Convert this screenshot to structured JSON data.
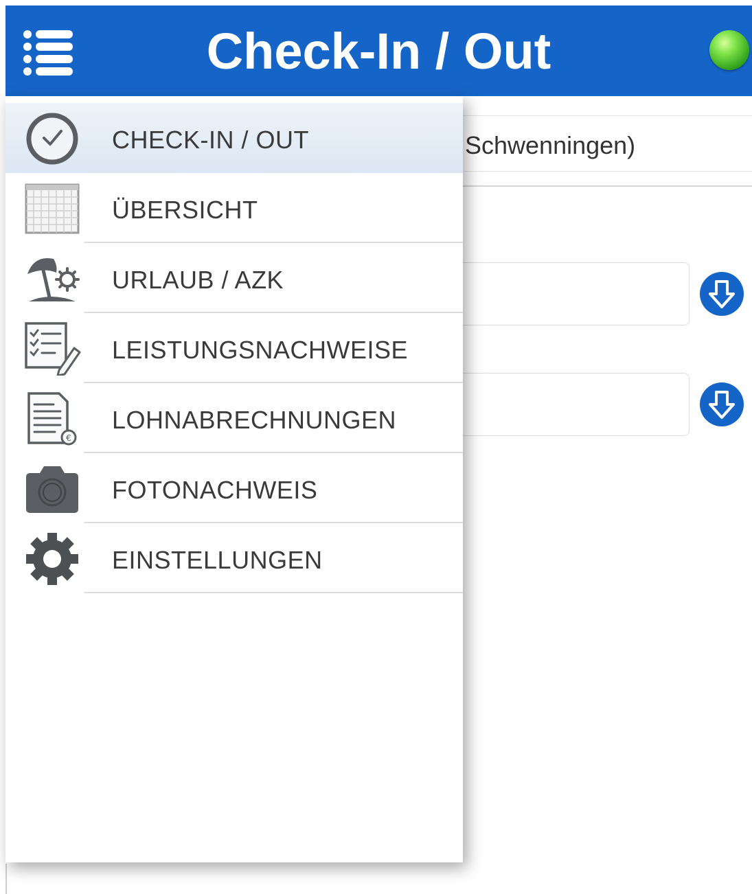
{
  "header": {
    "title": "Check-In / Out",
    "status_icon": "green-status-light",
    "menu_icon": "list-menu-icon"
  },
  "background": {
    "location_text": "Schwenningen)"
  },
  "menu": {
    "items": [
      {
        "label": "CHECK-IN / OUT",
        "icon": "clock-icon",
        "active": true
      },
      {
        "label": "ÜBERSICHT",
        "icon": "calendar-icon",
        "active": false
      },
      {
        "label": "URLAUB / AZK",
        "icon": "beach-umbrella-icon",
        "active": false
      },
      {
        "label": "LEISTUNGSNACHWEISE",
        "icon": "checklist-icon",
        "active": false
      },
      {
        "label": "LOHNABRECHNUNGEN",
        "icon": "payslip-icon",
        "active": false
      },
      {
        "label": "FOTONACHWEIS",
        "icon": "camera-icon",
        "active": false
      },
      {
        "label": "EINSTELLUNGEN",
        "icon": "gear-icon",
        "active": false
      }
    ]
  },
  "colors": {
    "header_bg": "#1565c8",
    "active_item_bg": "#e4ecf6",
    "status_green": "#4cc92a"
  }
}
